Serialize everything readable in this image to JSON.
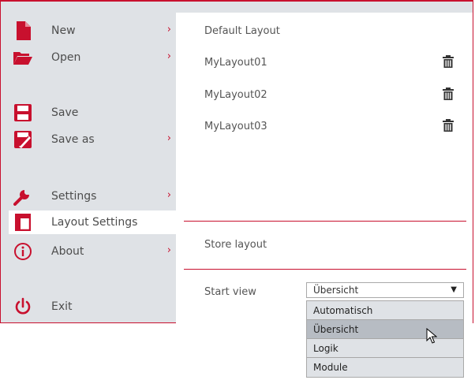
{
  "menu": {
    "new": "New",
    "open": "Open",
    "save": "Save",
    "save_as": "Save as",
    "settings": "Settings",
    "layout_settings": "Layout Settings",
    "about": "About",
    "exit": "Exit",
    "submenu_glyph": "›"
  },
  "layouts": {
    "default": "Default Layout",
    "items": [
      "MyLayout01",
      "MyLayout02",
      "MyLayout03"
    ]
  },
  "store_layout": "Store layout",
  "start_view": {
    "label": "Start view",
    "selected": "Übersicht",
    "options": [
      "Automatisch",
      "Übersicht",
      "Logik",
      "Module"
    ],
    "hovered_option": "Übersicht"
  },
  "colors": {
    "accent": "#c8102e",
    "sidebar_bg": "#dfe2e6",
    "panel_bg": "#ffffff"
  },
  "icons": {
    "new": "new-file-icon",
    "open": "folder-open-icon",
    "save": "save-icon",
    "save_as": "save-as-icon",
    "settings": "wrench-icon",
    "layout_settings": "layout-icon",
    "about": "info-icon",
    "exit": "power-icon",
    "delete": "trash-icon"
  }
}
